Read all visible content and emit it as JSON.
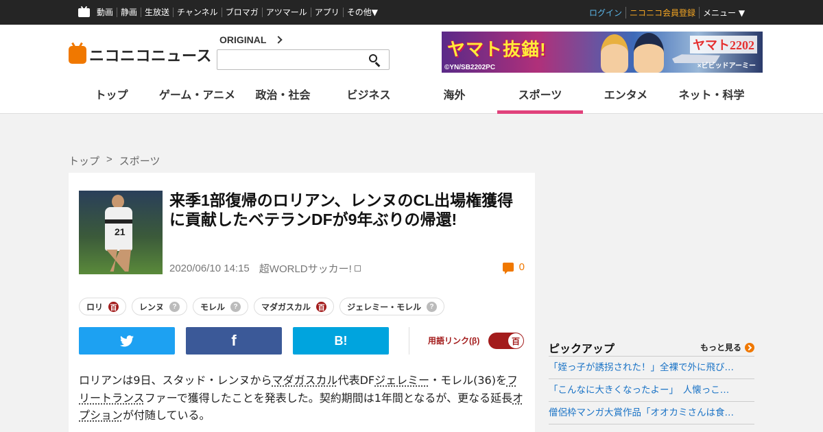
{
  "topbar": {
    "nav": [
      "動画",
      "静画",
      "生放送",
      "チャンネル",
      "ブロマガ",
      "アツマール",
      "アプリ",
      "その他▼"
    ],
    "login": "ログイン",
    "register": "ニコニコ会員登録",
    "menu": "メニュー ▼"
  },
  "header": {
    "logo_text": "ニコニコニュース",
    "original_label": "ORIGINAL",
    "search_value": "",
    "banner": {
      "title": "ヤマト抜錨!",
      "copyright": "©YN/SB2202PC",
      "logo": "ヤマト2202",
      "sub": "×ビビッドアーミー"
    },
    "categories": [
      "トップ",
      "ゲーム・アニメ",
      "政治・社会",
      "ビジネス",
      "海外",
      "スポーツ",
      "エンタメ",
      "ネット・科学"
    ],
    "active_category": "スポーツ"
  },
  "breadcrumb": [
    "トップ",
    ">",
    "スポーツ"
  ],
  "article": {
    "title": "来季1部復帰のロリアン、レンヌのCL出場権獲得に貢献したベテランDFが9年ぶりの帰還!",
    "date": "2020/06/10 14:15",
    "source": "超WORLDサッカー!",
    "comment_count": "0",
    "thumb_number": "21",
    "tags": [
      {
        "label": "ロリ",
        "dic": "百",
        "active": true
      },
      {
        "label": "レンヌ",
        "dic": "?",
        "active": false
      },
      {
        "label": "モレル",
        "dic": "?",
        "active": false
      },
      {
        "label": "マダガスカル",
        "dic": "百",
        "active": true
      },
      {
        "label": "ジェレミー・モレル",
        "dic": "?",
        "active": false
      }
    ],
    "share": {
      "twitter": "twitter-bird",
      "facebook": "f",
      "hatena": "B!"
    },
    "yougo_link_label": "用語リンク(β)",
    "yougo_toggle_icon": "百",
    "body": {
      "t1": "ロリアンは9日、スタッド・レンヌから",
      "l1": "マダガスカル",
      "t2": "代表DF",
      "l2": "ジェレミー",
      "t3": "・モレル(36)を",
      "l3": "フリートランス",
      "t4": "ファーで獲得したことを発表した。契約期間は1年間となるが、更なる延長",
      "l4": "オプション",
      "t5": "が付随している。"
    }
  },
  "sidebar": {
    "pickup_title": "ピックアップ",
    "more_label": "もっと見る",
    "items": [
      "「姪っ子が誘拐された！」全裸で外に飛び出した男性が…",
      "「こんなに大きくなったよー」　人懐っこい猫が…",
      "僧侶枠マンガ大賞作品「オオカミさんは食べられたい」…"
    ]
  }
}
